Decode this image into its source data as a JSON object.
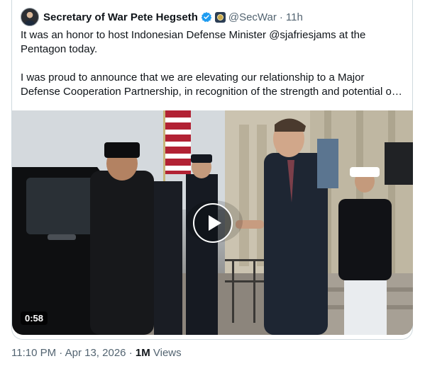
{
  "author": {
    "name": "Secretary of War Pete Hegseth",
    "handle": "@SecWar",
    "time": "11h"
  },
  "tweet": {
    "paragraph1": [
      "It was an honor to host Indonesian Defense Minister @sjafriesjams at the",
      "Pentagon today."
    ],
    "paragraph2": [
      "I was proud to announce that we are elevating our relationship to a Major",
      "Defense Cooperation Partnership, in recognition of the strength and potential o…"
    ]
  },
  "media": {
    "duration": "0:58"
  },
  "meta": {
    "timestamp": "11:10 PM",
    "date": "Apr 13, 2026",
    "views_count": "1M",
    "views_label": "Views"
  },
  "colors": {
    "text_primary": "#0f1419",
    "text_secondary": "#536471",
    "verified_blue": "#1d9bf0",
    "border": "#cfd9de"
  },
  "icons": [
    "verified-badge-icon",
    "org-badge-icon",
    "play-icon"
  ]
}
